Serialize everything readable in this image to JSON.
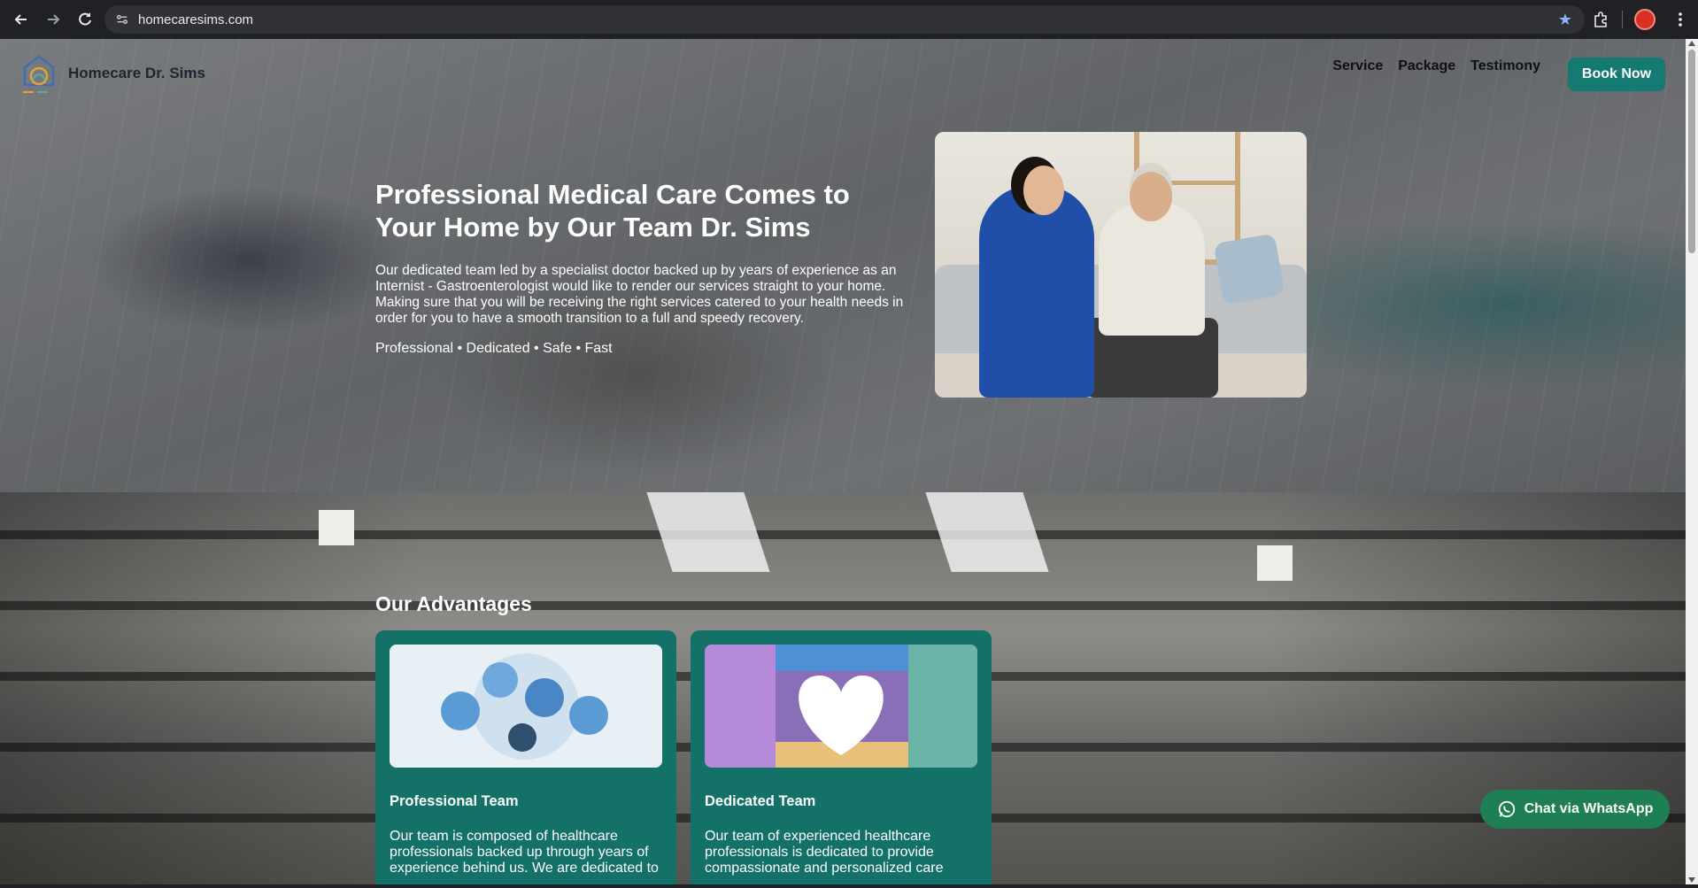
{
  "browser": {
    "url": "homecaresims.com"
  },
  "header": {
    "brand": "Homecare Dr. Sims",
    "nav": [
      "Service",
      "Package",
      "Testimony"
    ],
    "book_label": "Book Now"
  },
  "hero": {
    "title": "Professional Medical Care Comes to Your Home by Our Team Dr. Sims",
    "description": "Our dedicated team led by a specialist doctor backed up by years of experience as an Internist - Gastroenterologist would like to render our services straight to your home. Making sure that you will be receiving the right services catered to your health needs in order for you to have a smooth transition to a full and speedy recovery.",
    "tags": "Professional • Dedicated • Safe • Fast"
  },
  "advantages": {
    "title": "Our Advantages",
    "cards": [
      {
        "title": "Professional Team",
        "text": "Our team is composed of healthcare professionals backed up through years of experience behind us. We are dedicated to"
      },
      {
        "title": "Dedicated Team",
        "text": "Our team of experienced healthcare professionals is dedicated to provide compassionate and personalized care"
      }
    ]
  },
  "whatsapp": {
    "label": "Chat via WhatsApp"
  },
  "colors": {
    "accent": "#157a72",
    "whatsapp": "#1e7f54"
  }
}
